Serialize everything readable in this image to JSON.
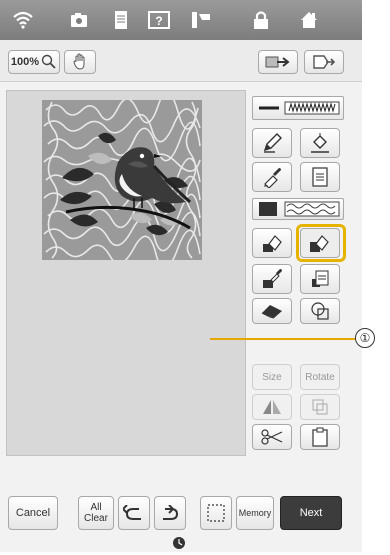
{
  "toolbar": {
    "zoom_label": "100%"
  },
  "side_panel": {
    "size_label": "Size",
    "rotate_label": "Rotate"
  },
  "bottom": {
    "cancel_label": "Cancel",
    "all_clear_label": "All\nClear",
    "memory_label": "Memory",
    "next_label": "Next"
  },
  "callout": {
    "number": "①"
  },
  "colors": {
    "accent_highlight": "#e6b400",
    "next_button_bg": "#3c3c3c"
  }
}
